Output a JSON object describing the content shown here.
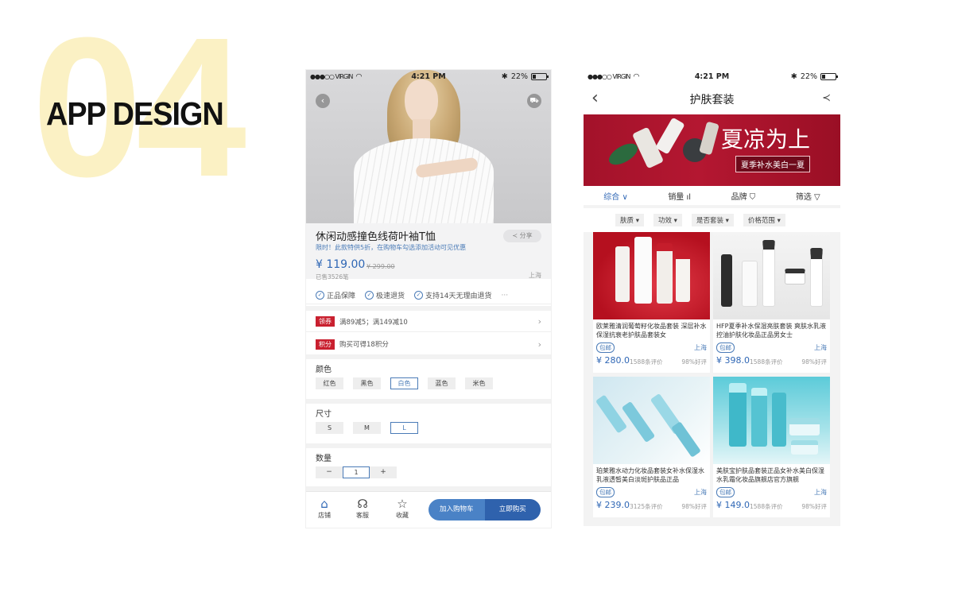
{
  "hero": {
    "number": "04",
    "title": "APP DESIGN"
  },
  "status": {
    "carrier": "●●●○○ VIRGIN",
    "time": "4:21 PM",
    "battery": "22%"
  },
  "detail": {
    "title": "休闲动感撞色线荷叶袖T恤",
    "promo": "限时！此款特供5折，在购物车勾选添加活动可见优惠",
    "share": "分享",
    "price": "¥ 119.00",
    "old_price": "¥ 299.00",
    "sold": "已售3526笔",
    "location": "上海",
    "guarantees": [
      "正品保障",
      "极速退货",
      "支持14天无理由退货"
    ],
    "more": "···",
    "coupon_tag": "领券",
    "coupon_text": "满89减5；满149减10",
    "points_tag": "积分",
    "points_text": "购买可得18积分",
    "color_label": "颜色",
    "colors": [
      "红色",
      "黑色",
      "白色",
      "蓝色",
      "米色"
    ],
    "size_label": "尺寸",
    "sizes": [
      "S",
      "M",
      "L"
    ],
    "qty_label": "数量",
    "qty_minus": "−",
    "qty_value": "1",
    "qty_plus": "+",
    "tab_store": "店铺",
    "tab_service": "客服",
    "tab_fav": "收藏",
    "add_cart": "加入购物车",
    "buy_now": "立即购买"
  },
  "list": {
    "title": "护肤套装",
    "banner_title": "夏凉为上",
    "banner_sub": "夏季补水美白一夏",
    "sort": [
      "综合 ∨",
      "销量 ıl",
      "品牌 ⛉",
      "筛选 ▽"
    ],
    "filters": [
      "肤质 ▾",
      "功效 ▾",
      "是否套装 ▾",
      "价格范围 ▾"
    ],
    "products": [
      {
        "name": "欧莱雅清润葡萄籽化妆品套装 深层补水保湿抗衰老护肤品套装女",
        "tag": "包邮",
        "city": "上海",
        "price": "¥ 280.0",
        "reviews": "1588条评价",
        "rating": "98%好评"
      },
      {
        "name": "HFP夏季补水保湿亮肤套装 爽肤水乳液控油护肤化妆品正品男女士",
        "tag": "包邮",
        "city": "上海",
        "price": "¥ 398.0",
        "reviews": "1588条评价",
        "rating": "98%好评"
      },
      {
        "name": "珀莱雅水动力化妆品套装女补水保湿水乳液透皙美白淡斑护肤品正品",
        "tag": "包邮",
        "city": "上海",
        "price": "¥ 239.0",
        "reviews": "3125条评价",
        "rating": "98%好评"
      },
      {
        "name": "美肤宝护肤品套装正品女补水美白保湿水乳霜化妆品旗舰店官方旗舰",
        "tag": "包邮",
        "city": "上海",
        "price": "¥ 149.0",
        "reviews": "1588条评价",
        "rating": "98%好评"
      }
    ]
  },
  "colors": {
    "accent": "#2f67b5",
    "accent_light": "#4a82c6",
    "tag_red": "#c9202f",
    "banner_red": "#a3122a",
    "hero_yellow": "#fbf1c4"
  }
}
